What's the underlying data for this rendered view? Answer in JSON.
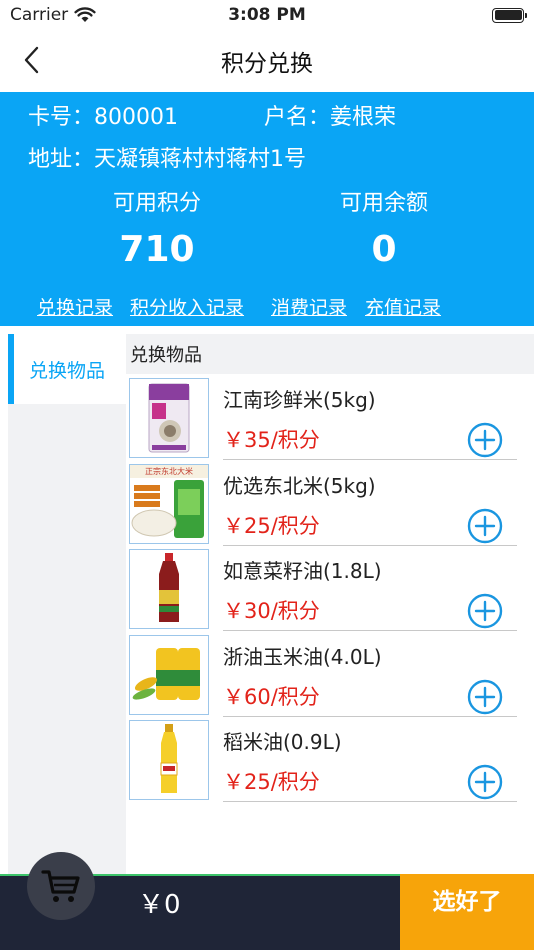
{
  "status_bar": {
    "carrier": "Carrier",
    "time": "3:08 PM"
  },
  "nav": {
    "title": "积分兑换"
  },
  "account": {
    "card_label": "卡号：800001",
    "name_label": "户名：姜根荣",
    "address_label": "地址：天凝镇蒋村村蒋村1号",
    "points_label": "可用积分",
    "points_value": "710",
    "balance_label": "可用余额",
    "balance_value": "0"
  },
  "records": [
    {
      "label": "兑换记录"
    },
    {
      "label": "积分收入记录"
    },
    {
      "label": "消费记录"
    },
    {
      "label": "充值记录"
    }
  ],
  "sidebar": {
    "items": [
      {
        "label": "兑换物品"
      }
    ]
  },
  "section": {
    "title": "兑换物品"
  },
  "products": [
    {
      "name": "江南珍鲜米(5kg)",
      "price": "￥35/积分"
    },
    {
      "name": "优选东北米(5kg)",
      "price": "￥25/积分",
      "thumb_caption": "正宗东北大米"
    },
    {
      "name": "如意菜籽油(1.8L)",
      "price": "￥30/积分"
    },
    {
      "name": "浙油玉米油(4.0L)",
      "price": "￥60/积分"
    },
    {
      "name": "稻米油(0.9L)",
      "price": "￥25/积分"
    }
  ],
  "cart": {
    "total": "￥0",
    "confirm_label": "选好了"
  },
  "colors": {
    "primary": "#0aa5f5",
    "price": "#e2231a",
    "confirm": "#f7a40a",
    "bottom_bar": "#1f2537"
  }
}
